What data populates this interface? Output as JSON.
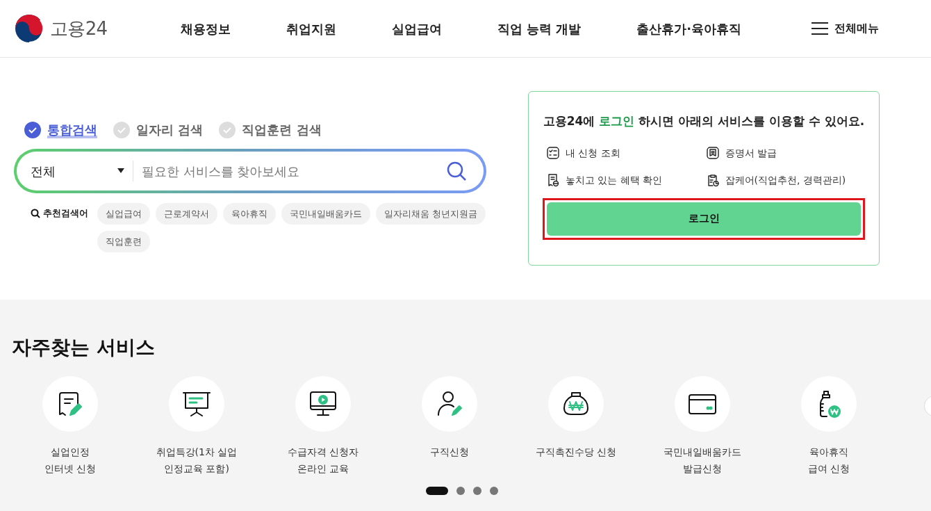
{
  "header": {
    "logo_text": "고용24",
    "nav": [
      "채용정보",
      "취업지원",
      "실업급여",
      "직업 능력 개발",
      "출산휴가·육아휴직"
    ],
    "menu_label": "전체메뉴"
  },
  "search": {
    "scopes": [
      {
        "label": "통합검색",
        "selected": true
      },
      {
        "label": "일자리 검색",
        "selected": false
      },
      {
        "label": "직업훈련 검색",
        "selected": false
      }
    ],
    "category": "전체",
    "placeholder": "필요한 서비스를 찾아보세요",
    "recommend_label": "추천검색어",
    "keywords": [
      "실업급여",
      "근로계약서",
      "육아휴직",
      "국민내일배움카드",
      "일자리채움 청년지원금",
      "직업훈련"
    ]
  },
  "login_card": {
    "title_before": "고용24에",
    "title_highlight": "로그인",
    "title_after": "하시면 아래의 서비스를 이용할 수 있어요.",
    "services": [
      {
        "kind": "list",
        "label": "내 신청 조회"
      },
      {
        "kind": "certificate",
        "label": "증명서 발급"
      },
      {
        "kind": "receipt",
        "label": "놓치고 있는 혜택 확인"
      },
      {
        "kind": "clipboard",
        "label": "잡케어(직업추천, 경력관리)"
      }
    ],
    "button": {
      "label": "로그인",
      "highlighted": true
    }
  },
  "frequent": {
    "title": "자주찾는 서비스",
    "items": [
      {
        "kind": "document",
        "lines": [
          "실업인정",
          "인터넷 신청"
        ]
      },
      {
        "kind": "presentation",
        "lines": [
          "취업특강(1차 실업",
          "인정교육 포함)"
        ]
      },
      {
        "kind": "monitor",
        "lines": [
          "수급자격 신청자",
          "온라인 교육"
        ]
      },
      {
        "kind": "person",
        "lines": [
          "구직신청"
        ]
      },
      {
        "kind": "moneybag",
        "lines": [
          "구직촉진수당 신청"
        ]
      },
      {
        "kind": "card",
        "lines": [
          "국민내일배움카드",
          "발급신청"
        ]
      },
      {
        "kind": "bottle",
        "lines": [
          "육아휴직",
          "급여 신청"
        ]
      }
    ],
    "pages": [
      {
        "selected": true
      },
      {
        "selected": false
      },
      {
        "selected": false
      },
      {
        "selected": false
      }
    ]
  }
}
